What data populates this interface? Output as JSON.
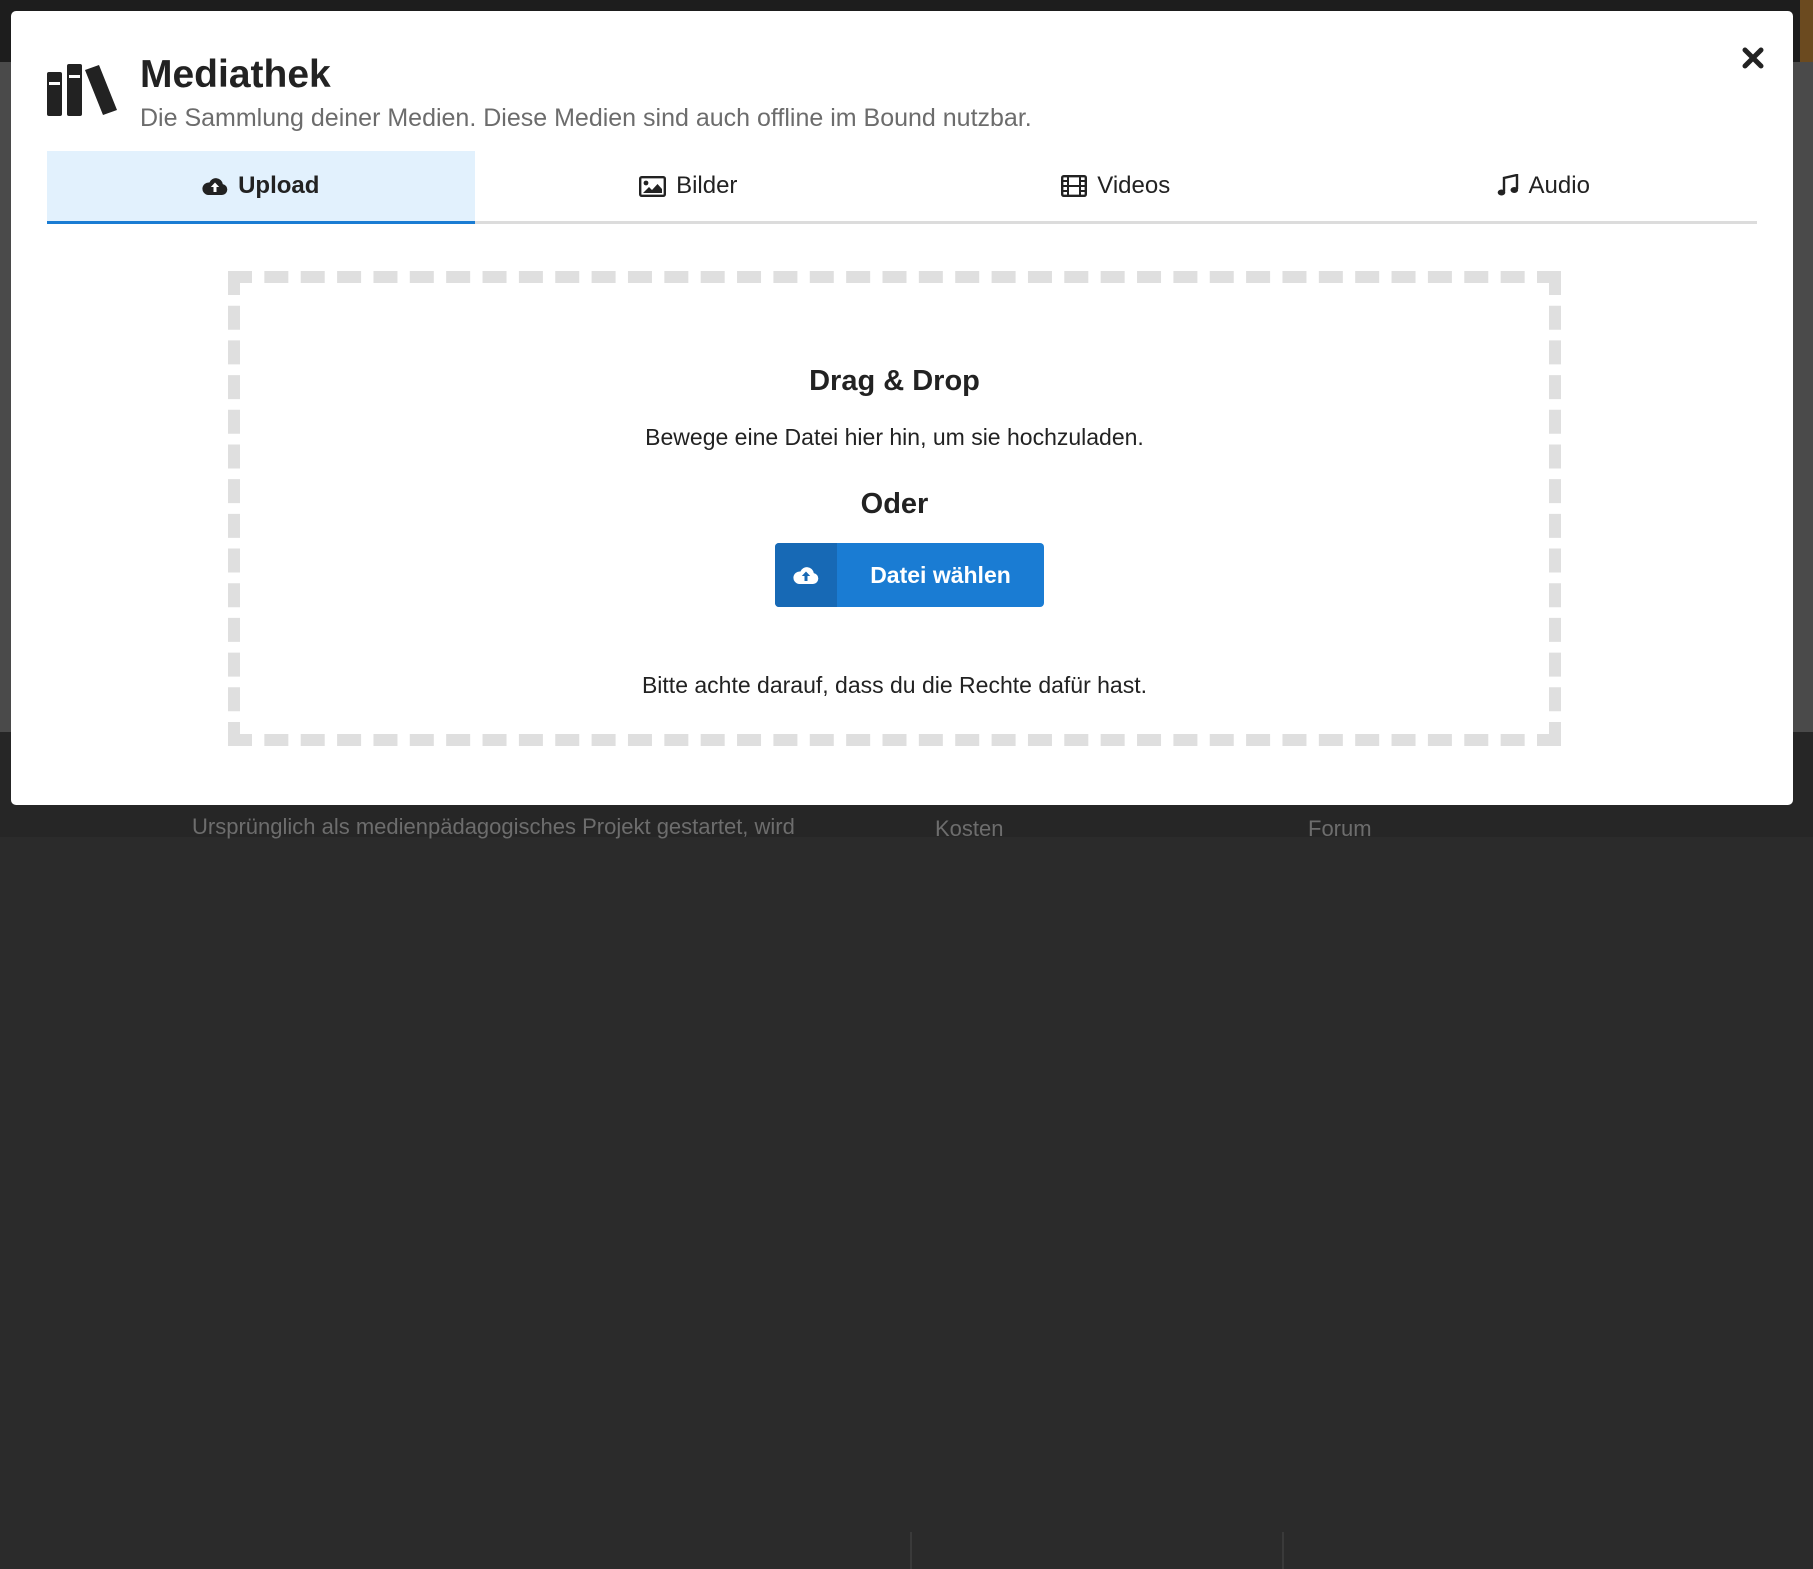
{
  "header": {
    "icon": "books-icon",
    "title": "Mediathek",
    "subtitle": "Die Sammlung deiner Medien. Diese Medien sind auch offline im Bound nutzbar.",
    "close_icon": "close-icon"
  },
  "tabs": [
    {
      "label": "Upload",
      "icon": "cloud-upload-icon",
      "active": true
    },
    {
      "label": "Bilder",
      "icon": "image-icon",
      "active": false
    },
    {
      "label": "Videos",
      "icon": "film-icon",
      "active": false
    },
    {
      "label": "Audio",
      "icon": "music-note-icon",
      "active": false
    }
  ],
  "dropzone": {
    "heading": "Drag & Drop",
    "instruction": "Bewege eine Datei hier hin, um sie hochzuladen.",
    "or_label": "Oder",
    "button_label": "Datei wählen",
    "button_icon": "cloud-upload-icon",
    "notice": "Bitte achte darauf, dass du die Rechte dafür hast."
  },
  "background": {
    "line1": "Ursprünglich als medienpädagogisches Projekt gestartet, wird",
    "link1": "Kosten",
    "link2": "Forum"
  },
  "colors": {
    "accent": "#1a7cd3",
    "active_tab_bg": "#e2f1fd",
    "dropzone_border": "#dfdfdf"
  }
}
